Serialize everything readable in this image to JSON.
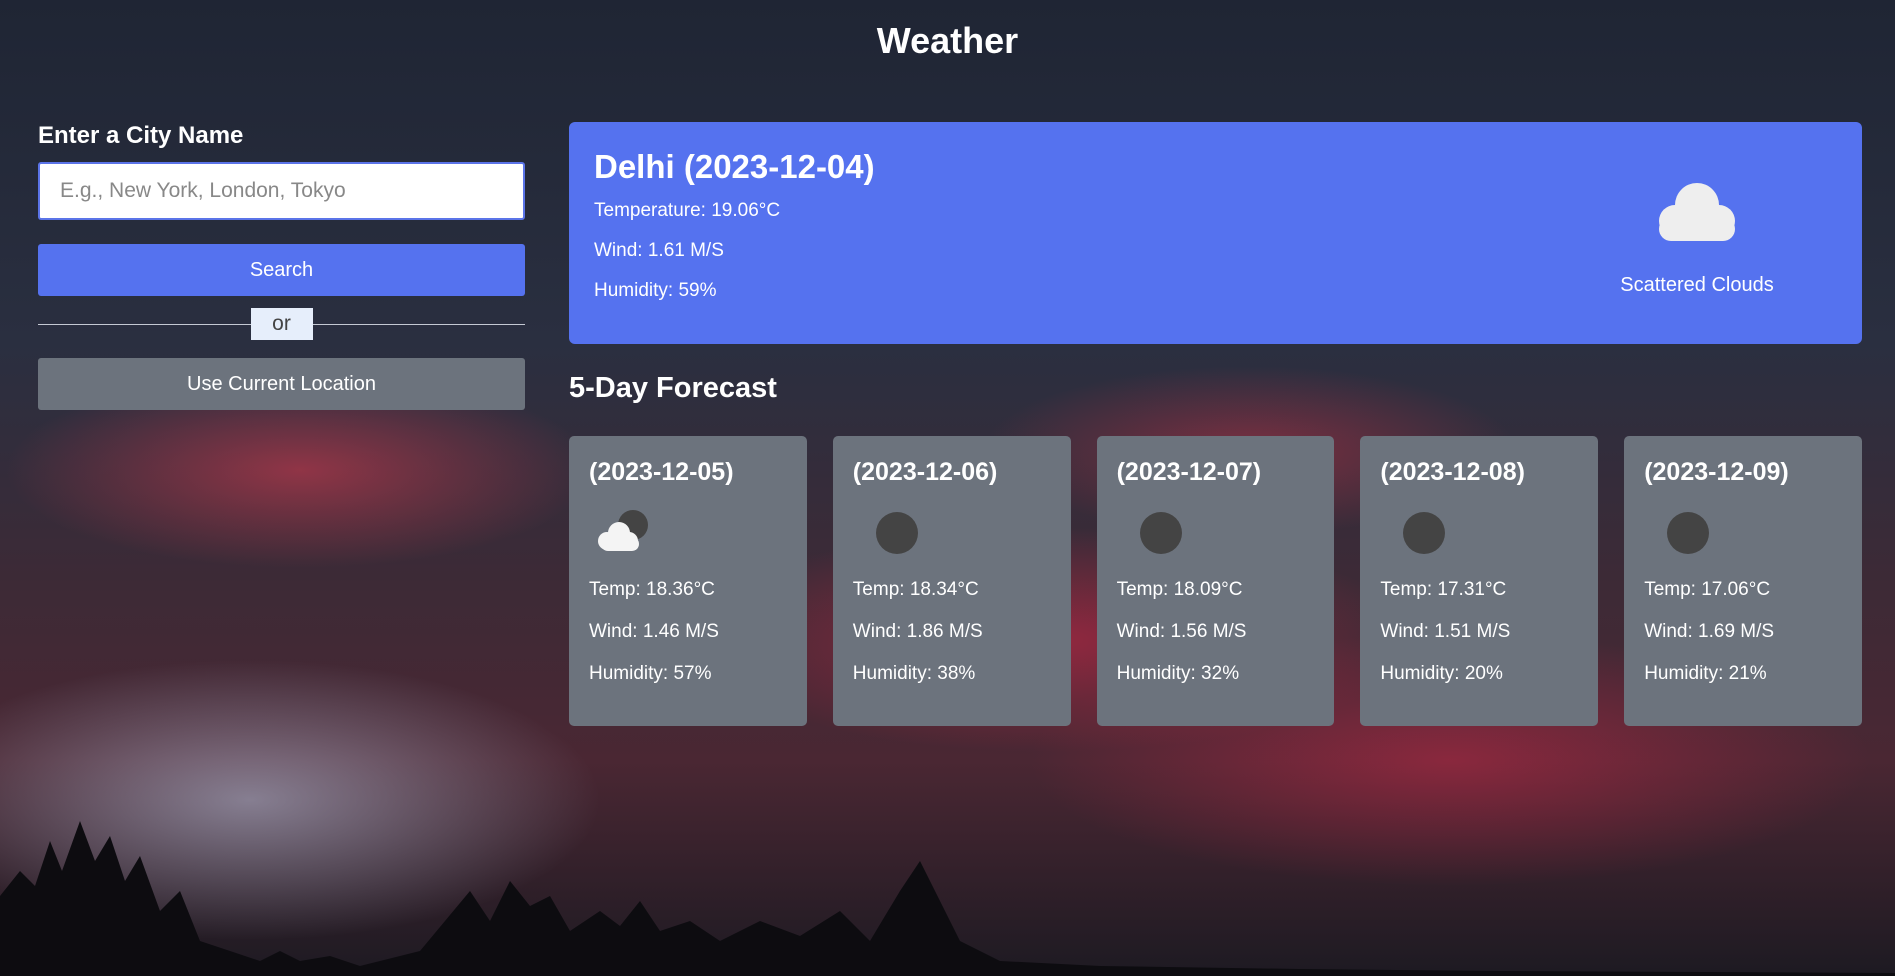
{
  "header": {
    "title": "Weather"
  },
  "search": {
    "heading": "Enter a City Name",
    "placeholder": "E.g., New York, London, Tokyo",
    "value": "",
    "search_label": "Search",
    "or_label": "or",
    "location_label": "Use Current Location"
  },
  "current": {
    "title": "Delhi (2023-12-04)",
    "temperature": "Temperature: 19.06°C",
    "wind": "Wind: 1.61 M/S",
    "humidity": "Humidity: 59%",
    "description": "Scattered Clouds",
    "icon": "cloud-icon"
  },
  "forecast": {
    "title": "5-Day Forecast",
    "days": [
      {
        "date": "(2023-12-05)",
        "icon": "cloud-moon-icon",
        "temp": "Temp: 18.36°C",
        "wind": "Wind: 1.46 M/S",
        "humidity": "Humidity: 57%"
      },
      {
        "date": "(2023-12-06)",
        "icon": "moon-icon",
        "temp": "Temp: 18.34°C",
        "wind": "Wind: 1.86 M/S",
        "humidity": "Humidity: 38%"
      },
      {
        "date": "(2023-12-07)",
        "icon": "moon-icon",
        "temp": "Temp: 18.09°C",
        "wind": "Wind: 1.56 M/S",
        "humidity": "Humidity: 32%"
      },
      {
        "date": "(2023-12-08)",
        "icon": "moon-icon",
        "temp": "Temp: 17.31°C",
        "wind": "Wind: 1.51 M/S",
        "humidity": "Humidity: 20%"
      },
      {
        "date": "(2023-12-09)",
        "icon": "moon-icon",
        "temp": "Temp: 17.06°C",
        "wind": "Wind: 1.69 M/S",
        "humidity": "Humidity: 21%"
      }
    ]
  },
  "colors": {
    "primary": "#5572ef",
    "secondary": "#6c737d"
  }
}
